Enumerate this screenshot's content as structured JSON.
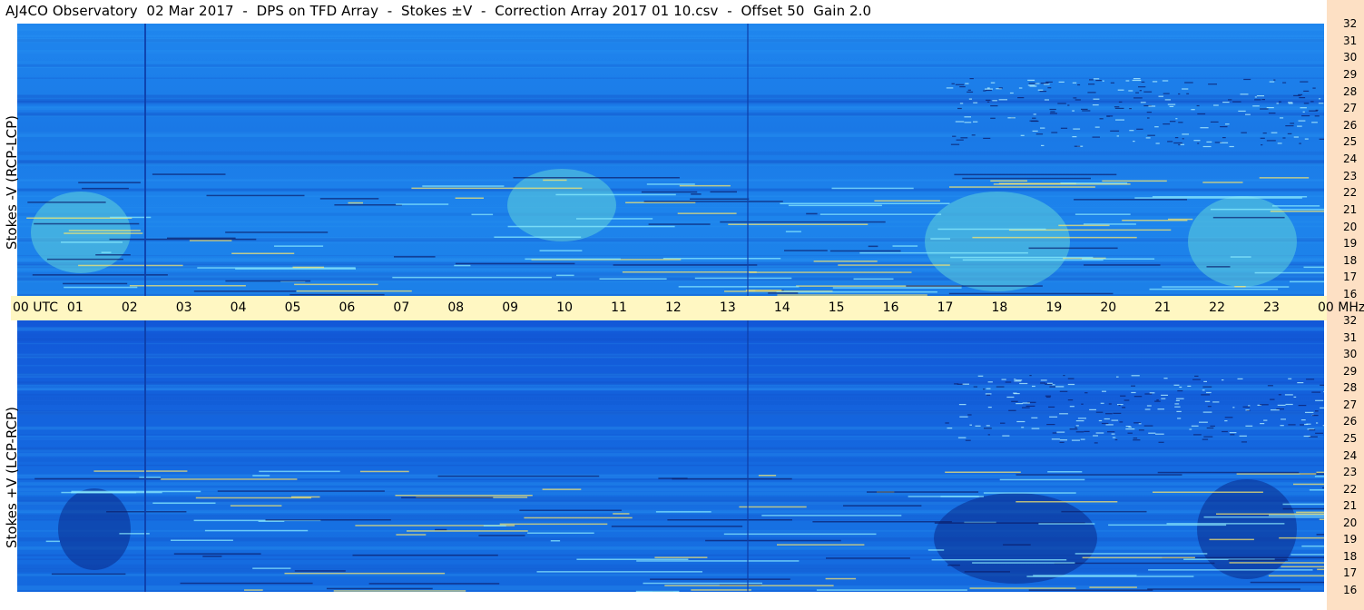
{
  "title": "AJ4CO Observatory  02 Mar 2017  -  DPS on TFD Array  -  Stokes ±V  -  Correction Array 2017 01 10.csv  -  Offset 50  Gain 2.0",
  "colors": {
    "time_bar": "#fff7c2",
    "freq_strip": "#fde0c4",
    "spectrogram_low": "#1258d8",
    "spectrogram_mid": "#1f86ee",
    "spectrogram_high": "#7fe0ff"
  },
  "chart_data": [
    {
      "type": "heatmap",
      "panel": "top",
      "ylabel": "Stokes -V (RCP-LCP)",
      "x_axis_labels": [
        "00 UTC",
        "01",
        "02",
        "03",
        "04",
        "05",
        "06",
        "07",
        "08",
        "09",
        "10",
        "11",
        "12",
        "13",
        "14",
        "15",
        "16",
        "17",
        "18",
        "19",
        "20",
        "21",
        "22",
        "23",
        "00 MHz"
      ],
      "xlim": [
        0,
        24
      ],
      "y_ticks": [
        32,
        31,
        30,
        29,
        28,
        27,
        26,
        25,
        24,
        23,
        22,
        21,
        20,
        19,
        18,
        17,
        16
      ],
      "ylim": [
        16,
        32
      ]
    },
    {
      "type": "heatmap",
      "panel": "bottom",
      "ylabel": "Stokes +V (LCP-RCP)",
      "x_axis_labels": [
        "00 UTC",
        "01",
        "02",
        "03",
        "04",
        "05",
        "06",
        "07",
        "08",
        "09",
        "10",
        "11",
        "12",
        "13",
        "14",
        "15",
        "16",
        "17",
        "18",
        "19",
        "20",
        "21",
        "22",
        "23",
        "00 MHz"
      ],
      "xlim": [
        0,
        24
      ],
      "y_ticks": [
        32,
        31,
        30,
        29,
        28,
        27,
        26,
        25,
        24,
        23,
        22,
        21,
        20,
        19,
        18,
        17,
        16
      ],
      "ylim": [
        16,
        32
      ]
    }
  ]
}
